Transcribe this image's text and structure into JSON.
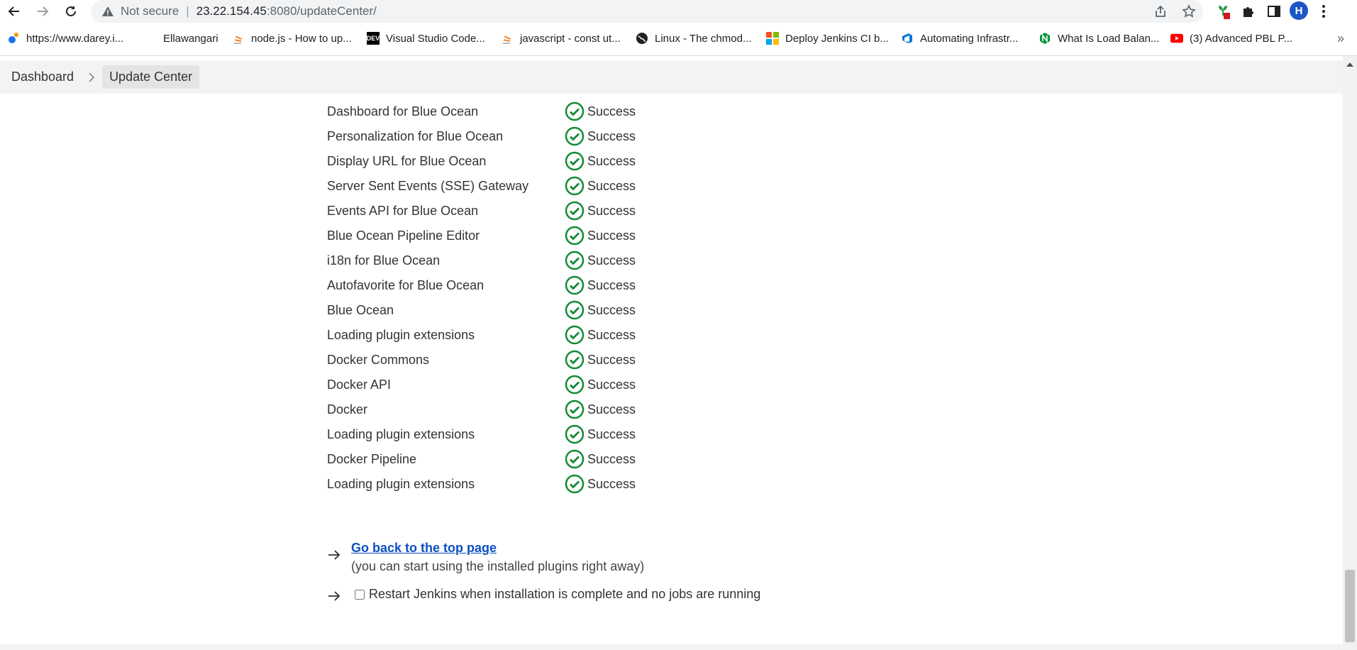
{
  "browser": {
    "address": {
      "security_label": "Not secure",
      "host": "23.22.154.45",
      "path": ":8080/updateCenter/"
    },
    "profile_initial": "H",
    "bookmarks": [
      {
        "label": "https://www.darey.i...",
        "icon": "darey-icon"
      },
      {
        "label": "Ellawangari",
        "icon": "blank-icon"
      },
      {
        "label": "node.js - How to up...",
        "icon": "stackoverflow-icon"
      },
      {
        "label": "Visual Studio Code...",
        "icon": "dev-icon"
      },
      {
        "label": "javascript - const ut...",
        "icon": "stackoverflow-icon"
      },
      {
        "label": "Linux - The chmod...",
        "icon": "globe-icon"
      },
      {
        "label": "Deploy Jenkins CI b...",
        "icon": "microsoft-icon"
      },
      {
        "label": "Automating Infrastr...",
        "icon": "azure-devops-icon"
      },
      {
        "label": "What Is Load Balan...",
        "icon": "nginx-icon"
      },
      {
        "label": "(3) Advanced PBL P...",
        "icon": "youtube-icon"
      }
    ],
    "bookmarks_overflow": "»"
  },
  "breadcrumb": {
    "items": [
      "Dashboard",
      "Update Center"
    ]
  },
  "plugins": [
    {
      "name": "Dashboard for Blue Ocean",
      "status": "Success"
    },
    {
      "name": "Personalization for Blue Ocean",
      "status": "Success"
    },
    {
      "name": "Display URL for Blue Ocean",
      "status": "Success"
    },
    {
      "name": "Server Sent Events (SSE) Gateway",
      "status": "Success"
    },
    {
      "name": "Events API for Blue Ocean",
      "status": "Success"
    },
    {
      "name": "Blue Ocean Pipeline Editor",
      "status": "Success"
    },
    {
      "name": "i18n for Blue Ocean",
      "status": "Success"
    },
    {
      "name": "Autofavorite for Blue Ocean",
      "status": "Success"
    },
    {
      "name": "Blue Ocean",
      "status": "Success"
    },
    {
      "name": "Loading plugin extensions",
      "status": "Success"
    },
    {
      "name": "Docker Commons",
      "status": "Success"
    },
    {
      "name": "Docker API",
      "status": "Success"
    },
    {
      "name": "Docker",
      "status": "Success"
    },
    {
      "name": "Loading plugin extensions",
      "status": "Success"
    },
    {
      "name": "Docker Pipeline",
      "status": "Success"
    },
    {
      "name": "Loading plugin extensions",
      "status": "Success"
    }
  ],
  "next_steps": {
    "back_link": "Go back to the top page",
    "back_note": "(you can start using the installed plugins right away)",
    "restart_label": "Restart Jenkins when installation is complete and no jobs are running",
    "restart_checked": false
  },
  "colors": {
    "success_green": "#138a36",
    "link_blue": "#0b4fc2",
    "breadcrumb_bg": "#f3f3f3"
  }
}
